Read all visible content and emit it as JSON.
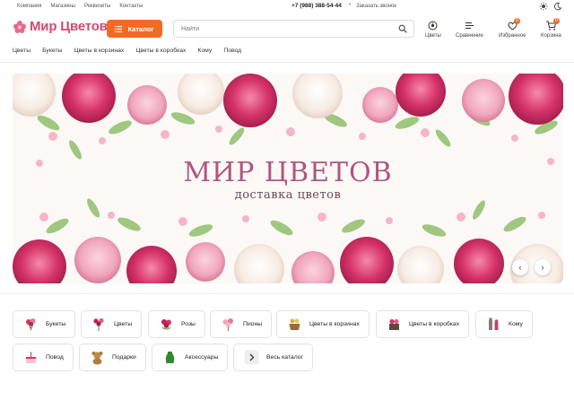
{
  "topbar": {
    "links": [
      "Компания",
      "Магазины",
      "Реквизиты",
      "Контакты"
    ],
    "phone": "+7 (988) 388-54-44",
    "callback": "Заказать звонок"
  },
  "header": {
    "logo_text": "Мир Цветов",
    "catalog_label": "Каталог",
    "search_placeholder": "Найти",
    "items": [
      {
        "label": "Цветы",
        "icon": "flower-icon"
      },
      {
        "label": "Сравнение",
        "icon": "compare-icon"
      },
      {
        "label": "Избранное",
        "icon": "heart-icon",
        "badge": "0"
      },
      {
        "label": "Корзина",
        "icon": "cart-icon",
        "badge": "0"
      }
    ]
  },
  "nav": [
    "Цветы",
    "Букеты",
    "Цветы в корзинах",
    "Цветы в коробках",
    "Кому",
    "Повод"
  ],
  "banner": {
    "title": "МИР ЦВЕТОВ",
    "subtitle": "доставка цветов"
  },
  "categories": [
    {
      "label": "Букеты",
      "icon": "bouquet-icon"
    },
    {
      "label": "Цветы",
      "icon": "flowers-icon"
    },
    {
      "label": "Розы",
      "icon": "roses-icon"
    },
    {
      "label": "Пионы",
      "icon": "peonies-icon"
    },
    {
      "label": "Цветы в корзинах",
      "icon": "basket-icon"
    },
    {
      "label": "Цветы в коробках",
      "icon": "box-icon"
    },
    {
      "label": "Кому",
      "icon": "people-icon"
    },
    {
      "label": "Повод",
      "icon": "cake-icon"
    },
    {
      "label": "Подарки",
      "icon": "teddy-bear-icon"
    },
    {
      "label": "Аксессуары",
      "icon": "vase-icon"
    },
    {
      "label": "Весь каталог",
      "icon": "chevron-right-icon"
    }
  ],
  "colors": {
    "accent": "#f26b25",
    "brand": "#d24a6f",
    "banner_title": "#b1557f"
  }
}
